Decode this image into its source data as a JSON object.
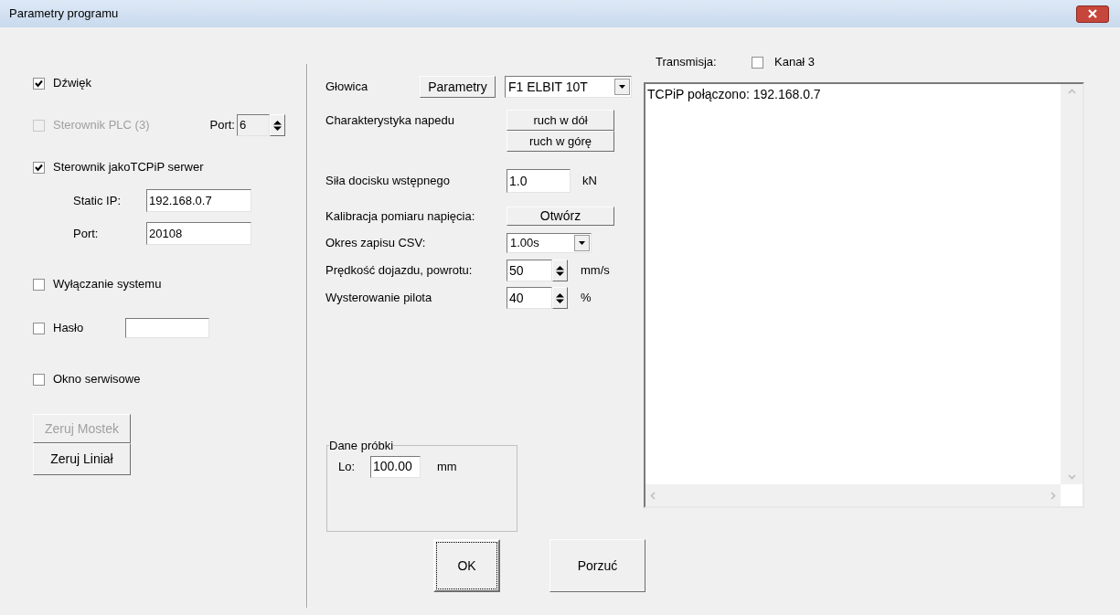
{
  "window": {
    "title": "Parametry programu"
  },
  "sound": {
    "label": "Dźwięk",
    "checked": true
  },
  "plc": {
    "label": "Sterownik PLC (3)",
    "checked": false,
    "disabled": true,
    "port_label": "Port:",
    "port": "6"
  },
  "tcpip": {
    "label": "Sterownik jakoTCPiP serwer",
    "checked": true,
    "static_ip_label": "Static IP:",
    "static_ip": "192.168.0.7",
    "port_label": "Port:",
    "port": "20108"
  },
  "shutdown": {
    "label": "Wyłączanie systemu",
    "checked": false
  },
  "password": {
    "label": "Hasło",
    "checked": false
  },
  "service_window": {
    "label": "Okno serwisowe",
    "checked": false
  },
  "left_buttons": [
    {
      "label": "Zeruj Mostek",
      "disabled": true
    },
    {
      "label": "Zeruj Liniał",
      "disabled": false
    }
  ],
  "head": {
    "label": "Głowica",
    "button": "Parametry",
    "value": "F1 ELBIT 10T"
  },
  "drive": {
    "label": "Charakterystyka napedu",
    "buttons": [
      "ruch w dół",
      "ruch w górę"
    ]
  },
  "preload": {
    "label": "Siła docisku wstępnego",
    "value": "1.0",
    "unit": "kN"
  },
  "calibration": {
    "label": "Kalibracja pomiaru napięcia:",
    "button": "Otwórz"
  },
  "csv_period": {
    "label": "Okres zapisu CSV:",
    "value": "1.00s"
  },
  "speed": {
    "label": "Prędkość dojazdu, powrotu:",
    "value": "50",
    "unit": "mm/s"
  },
  "pilot": {
    "label": "Wysterowanie pilota",
    "value": "40",
    "unit": "%"
  },
  "sample": {
    "title": "Dane próbki",
    "label": "Lo:",
    "value": "100.00",
    "unit": "mm"
  },
  "transmission": {
    "label": "Transmisja:",
    "channel_label": "Kanał 3",
    "checked": false
  },
  "log": {
    "lines": [
      "TCPiP połączono: 192.168.0.7"
    ]
  },
  "buttons": [
    {
      "label": "OK",
      "default": true
    },
    {
      "label": "Porzuć",
      "default": false
    }
  ]
}
